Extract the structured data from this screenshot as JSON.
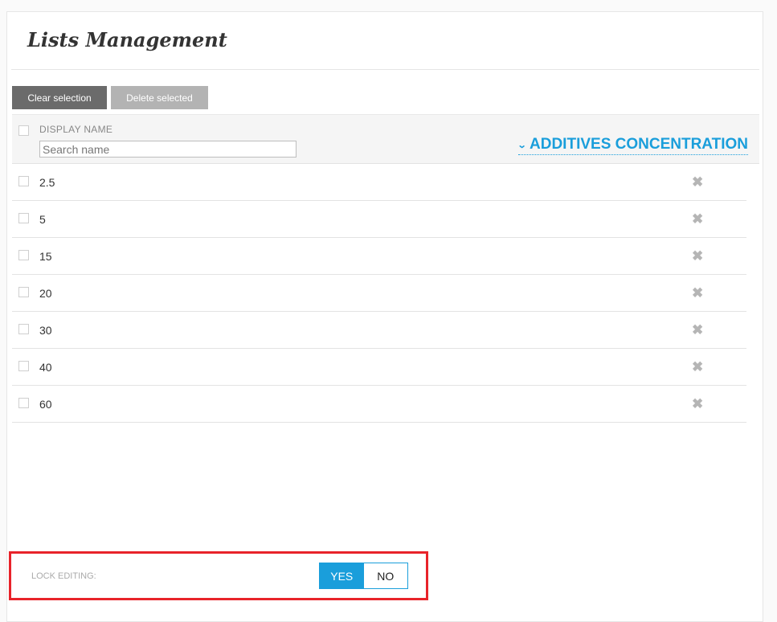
{
  "page": {
    "title": "Lists Management"
  },
  "toolbar": {
    "clear_label": "Clear selection",
    "delete_label": "Delete selected"
  },
  "table": {
    "column_header": "DISPLAY NAME",
    "search_placeholder": "Search name",
    "list_name": "ADDITIVES CONCENTRATION",
    "rows": [
      "2.5",
      "5",
      "15",
      "20",
      "30",
      "40",
      "60"
    ]
  },
  "icons": {
    "delete": "close-x-icon",
    "expand": "chevron-down-icon"
  },
  "lock": {
    "label": "LOCK EDITING:",
    "yes": "YES",
    "no": "NO",
    "selected": "YES"
  },
  "colors": {
    "accent": "#1a9edb",
    "highlight": "#e8232a"
  }
}
